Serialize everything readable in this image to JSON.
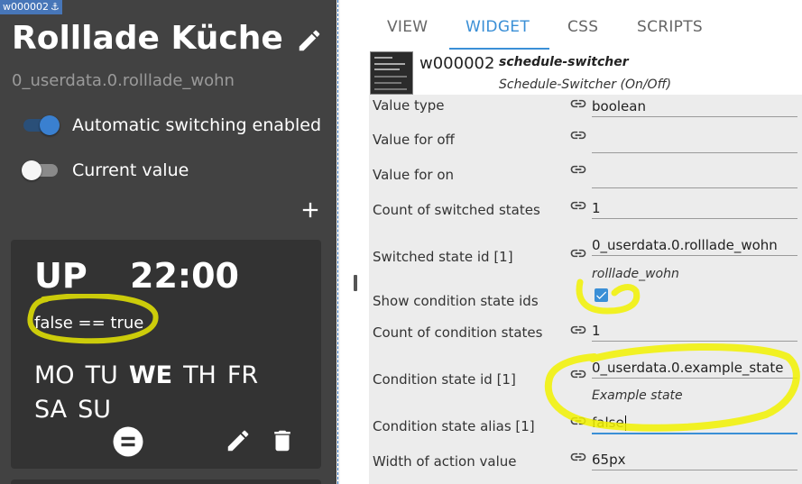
{
  "preview": {
    "widget_tag": "w000002",
    "title": "Rolllade Küche",
    "subtitle": "0_userdata.0.rolllade_wohn",
    "toggles": [
      {
        "label": "Automatic switching enabled",
        "state": "on"
      },
      {
        "label": "Current value",
        "state": "off"
      }
    ],
    "card": {
      "action": "UP",
      "time": "22:00",
      "condition": "false == true",
      "days": [
        {
          "label": "MO",
          "active": false
        },
        {
          "label": "TU",
          "active": false
        },
        {
          "label": "WE",
          "active": true
        },
        {
          "label": "TH",
          "active": false
        },
        {
          "label": "FR",
          "active": false
        },
        {
          "label": "SA",
          "active": false
        },
        {
          "label": "SU",
          "active": false
        }
      ]
    }
  },
  "tabs": [
    "VIEW",
    "WIDGET",
    "CSS",
    "SCRIPTS"
  ],
  "active_tab": "WIDGET",
  "widget": {
    "id": "w000002",
    "type": "schedule-switcher",
    "set_name": "Schedule-Switcher (On/Off)"
  },
  "attributes": [
    {
      "label": "Value type",
      "value": "boolean"
    },
    {
      "label": "Value for off",
      "value": ""
    },
    {
      "label": "Value for on",
      "value": ""
    },
    {
      "label": "Count of switched states",
      "value": "1"
    },
    {
      "label": "Switched state id [1]",
      "value": "0_userdata.0.rolllade_wohn",
      "hint": "rolllade_wohn"
    },
    {
      "label": "Show condition state ids",
      "checked": true
    },
    {
      "label": "Count of condition states",
      "value": "1"
    },
    {
      "label": "Condition state id [1]",
      "value": "0_userdata.0.example_state",
      "hint": "Example state"
    },
    {
      "label": "Condition state alias [1]",
      "value": "false"
    },
    {
      "label": "Width of action value",
      "value": "65px"
    }
  ],
  "colors": {
    "accent": "#3a8fd6",
    "widget_bg": "#424242",
    "card_bg": "#333333",
    "highlight": "#f2f200"
  }
}
